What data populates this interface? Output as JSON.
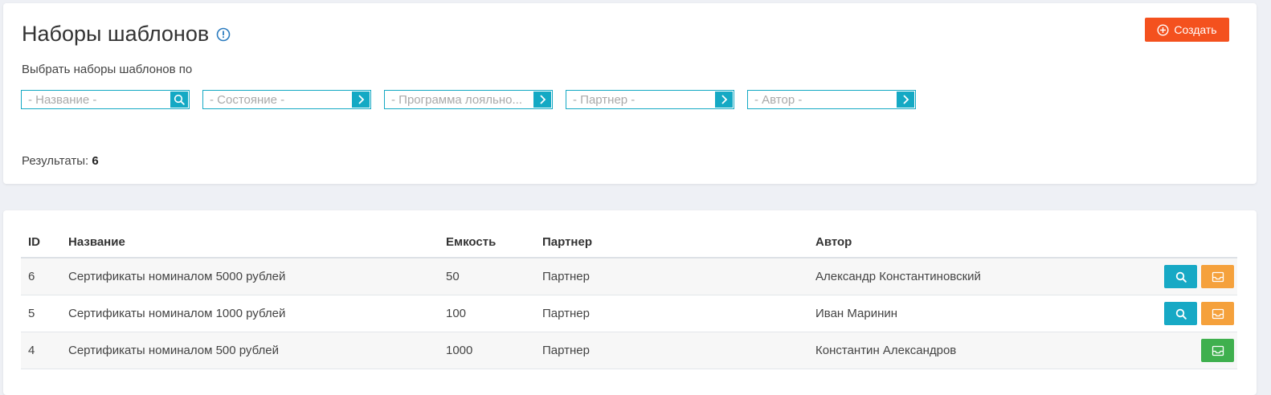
{
  "header": {
    "title": "Наборы шаблонов",
    "create_label": "Создать"
  },
  "filters": {
    "caption": "Выбрать наборы шаблонов по",
    "items": [
      {
        "placeholder": "- Название -",
        "icon": "search-icon"
      },
      {
        "placeholder": "- Состояние -",
        "icon": "chevron-right-icon"
      },
      {
        "placeholder": "- Программа лояльно...",
        "icon": "chevron-right-icon"
      },
      {
        "placeholder": "- Партнер -",
        "icon": "chevron-right-icon"
      },
      {
        "placeholder": "- Автор -",
        "icon": "chevron-right-icon"
      }
    ]
  },
  "results": {
    "label": "Результаты:",
    "count": "6"
  },
  "table": {
    "columns": {
      "id": "ID",
      "name": "Название",
      "capacity": "Емкость",
      "partner": "Партнер",
      "author": "Автор"
    },
    "rows": [
      {
        "id": "6",
        "name": "Сертификаты номиналом 5000 рублей",
        "capacity": "50",
        "partner": "Партнер",
        "author": "Александр Константиновский",
        "actions": [
          "view",
          "archive"
        ]
      },
      {
        "id": "5",
        "name": "Сертификаты номиналом 1000 рублей",
        "capacity": "100",
        "partner": "Партнер",
        "author": "Иван Маринин",
        "actions": [
          "view",
          "archive"
        ]
      },
      {
        "id": "4",
        "name": "Сертификаты номиналом 500 рублей",
        "capacity": "1000",
        "partner": "Партнер",
        "author": "Константин Александров",
        "actions": [
          "unarchive"
        ]
      }
    ]
  },
  "colors": {
    "accent": "#14a9c4",
    "create": "#f4511e",
    "archive": "#f5a13c",
    "unarchive": "#3fb04e"
  }
}
